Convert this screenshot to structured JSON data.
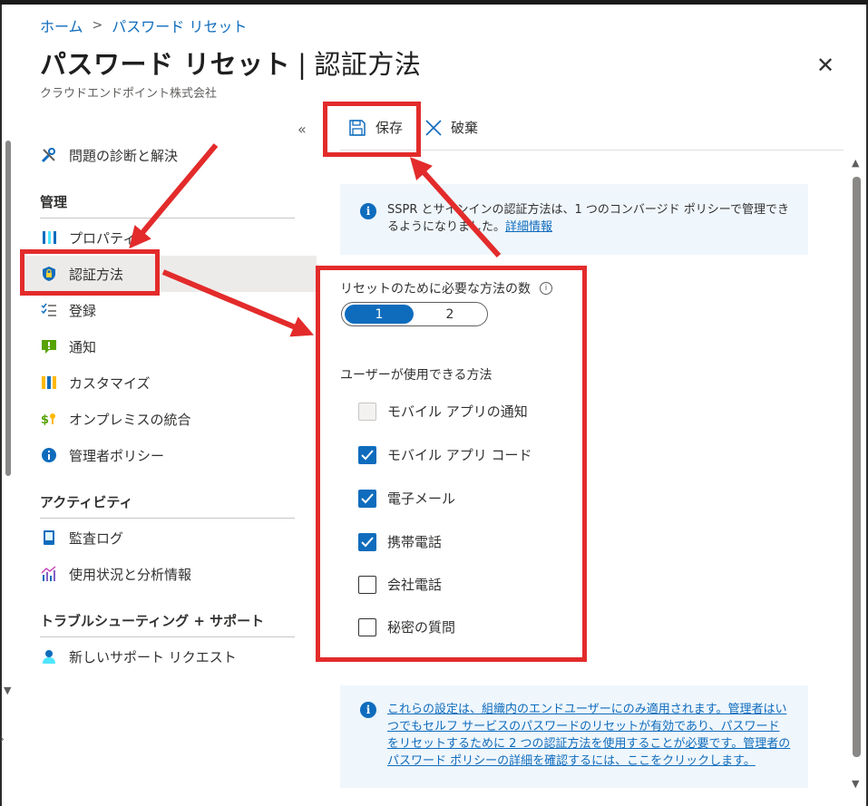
{
  "breadcrumb": {
    "home": "ホーム",
    "separator": ">",
    "current": "パスワード リセット"
  },
  "page": {
    "title_main": "パスワード リセット",
    "title_separator": "|",
    "title_sub": "認証方法",
    "more": "…",
    "close": "✕",
    "organization": "クラウドエンドポイント株式会社"
  },
  "sidebar": {
    "collapse": "«",
    "top_item": {
      "label": "問題の診断と解決",
      "icon": "wrench-icon"
    },
    "sections": [
      {
        "heading": "管理",
        "items": [
          {
            "label": "プロパティ",
            "icon": "properties-icon"
          },
          {
            "label": "認証方法",
            "icon": "shield-lock-icon",
            "selected": true
          },
          {
            "label": "登録",
            "icon": "checklist-icon"
          },
          {
            "label": "通知",
            "icon": "notification-icon"
          },
          {
            "label": "カスタマイズ",
            "icon": "customize-icon"
          },
          {
            "label": "オンプレミスの統合",
            "icon": "key-sync-icon"
          },
          {
            "label": "管理者ポリシー",
            "icon": "info-icon"
          }
        ]
      },
      {
        "heading": "アクティビティ",
        "items": [
          {
            "label": "監査ログ",
            "icon": "audit-log-icon"
          },
          {
            "label": "使用状況と分析情報",
            "icon": "analytics-icon"
          }
        ]
      },
      {
        "heading": "トラブルシューティング + サポート",
        "items": [
          {
            "label": "新しいサポート リクエスト",
            "icon": "support-person-icon"
          }
        ]
      }
    ]
  },
  "toolbar": {
    "save": "保存",
    "discard": "破棄"
  },
  "info_top": {
    "text": "SSPR とサインインの認証方法は、1 つのコンバージド ポリシーで管理できるようになりました。",
    "link": "詳細情報"
  },
  "form": {
    "required_label": "リセットのために必要な方法の数",
    "toggle_options": [
      "1",
      "2"
    ],
    "toggle_selected": "1",
    "methods_heading": "ユーザーが使用できる方法",
    "methods": [
      {
        "label": "モバイル アプリの通知",
        "state": "disabled"
      },
      {
        "label": "モバイル アプリ コード",
        "state": "checked"
      },
      {
        "label": "電子メール",
        "state": "checked"
      },
      {
        "label": "携帯電話",
        "state": "checked"
      },
      {
        "label": "会社電話",
        "state": "unchecked"
      },
      {
        "label": "秘密の質問",
        "state": "unchecked"
      }
    ]
  },
  "info_bottom": {
    "text": "これらの設定は、組織内のエンドユーザーにのみ適用されます。管理者はいつでもセルフ サービスのパスワードのリセットが有効であり、パスワードをリセットするために 2 つの認証方法を使用することが必要です。管理者のパスワード ポリシーの詳細を確認するには、ここをクリックします。"
  },
  "colors": {
    "accent": "#0f6cbd",
    "annotation_red": "#e32b2b",
    "selected_bg": "#edebe9",
    "info_bg": "#eff6fc"
  }
}
